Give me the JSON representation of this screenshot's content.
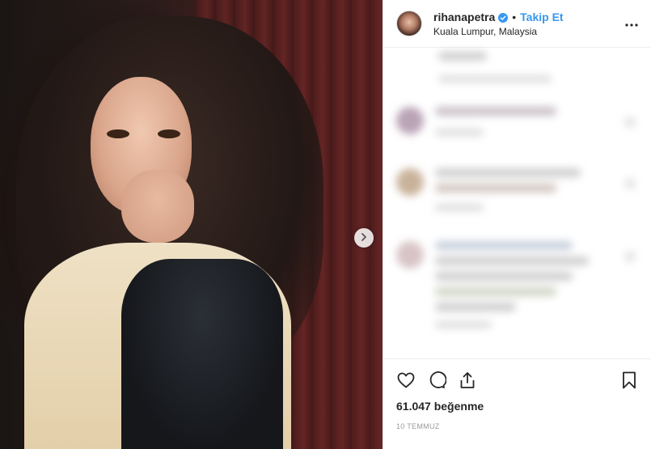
{
  "post": {
    "username": "rihanapetra",
    "separator": "•",
    "follow_label": "Takip Et",
    "location": "Kuala Lumpur, Malaysia",
    "likes": "61.047 beğenme",
    "date": "10 TEMMUZ"
  },
  "icons": {
    "verified": "verified-badge-icon",
    "more": "more-options-icon",
    "next": "chevron-right-icon",
    "like": "heart-icon",
    "comment": "comment-icon",
    "share": "share-icon",
    "save": "bookmark-icon"
  },
  "colors": {
    "follow": "#3897f0",
    "verified": "#3897f0",
    "text": "#262626",
    "muted": "#999999",
    "border": "#efefef"
  }
}
